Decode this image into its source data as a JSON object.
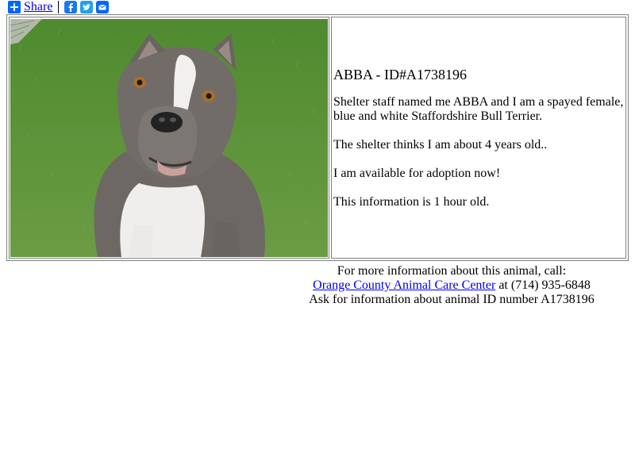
{
  "share": {
    "label": "Share",
    "icons": [
      "facebook-icon",
      "twitter-icon",
      "email-icon"
    ]
  },
  "animal": {
    "title": "ABBA - ID#A1738196",
    "description": "Shelter staff named me ABBA and I am a spayed female, blue and white Staffordshire Bull Terrier.",
    "age": "The shelter thinks I am about 4 years old..",
    "availability": "I am available for adoption now!",
    "freshness": "This information is 1 hour old.",
    "photo_alt": "ABBA"
  },
  "contact": {
    "line1": "For more information about this animal, call:",
    "center_name": "Orange County Animal Care Center",
    "phone_prefix": " at ",
    "phone": "(714) 935-6848",
    "line3": "Ask for information about animal ID number A1738196"
  },
  "colors": {
    "link": "#0000ee",
    "share_blue": "#0166ff",
    "facebook": "#1877f2",
    "twitter": "#1da1f2",
    "grass": "#5e8f3a",
    "dog_grey": "#6f6a66"
  }
}
